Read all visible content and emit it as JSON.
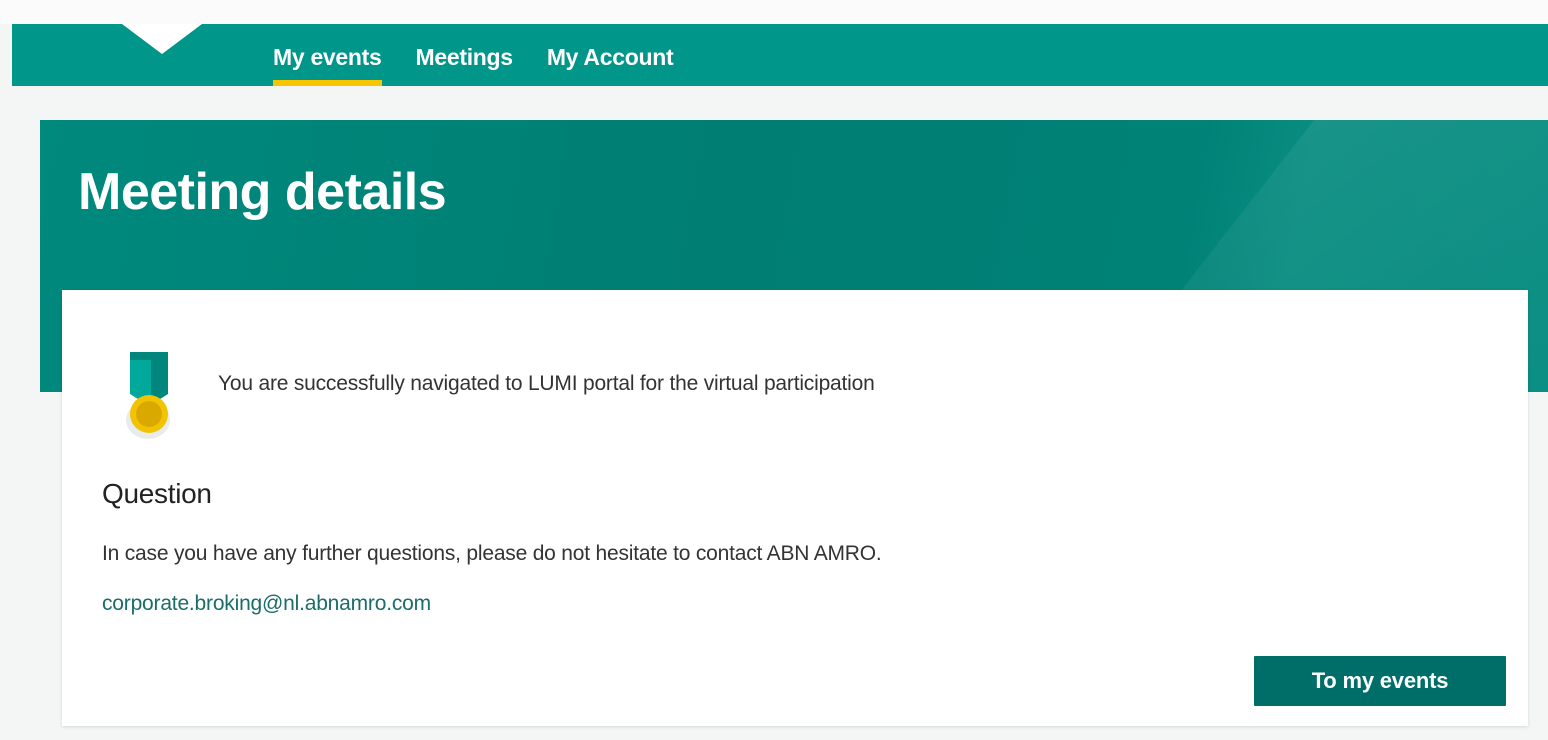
{
  "nav": {
    "items": [
      {
        "label": "My events",
        "active": true
      },
      {
        "label": "Meetings",
        "active": false
      },
      {
        "label": "My Account",
        "active": false
      }
    ]
  },
  "hero": {
    "title": "Meeting details"
  },
  "card": {
    "icon": "medal-icon",
    "success_message": "You are successfully navigated to LUMI portal for the virtual participation",
    "question_heading": "Question",
    "question_text": "In case you have any further questions, please do not hesitate to contact ABN AMRO.",
    "contact_email": "corporate.broking@nl.abnamro.com",
    "button_label": "To my events"
  },
  "colors": {
    "brand_teal": "#00968a",
    "hero_teal": "#007e73",
    "button_teal": "#006e68",
    "accent_yellow": "#f7c600",
    "link_teal": "#1a6d69"
  }
}
